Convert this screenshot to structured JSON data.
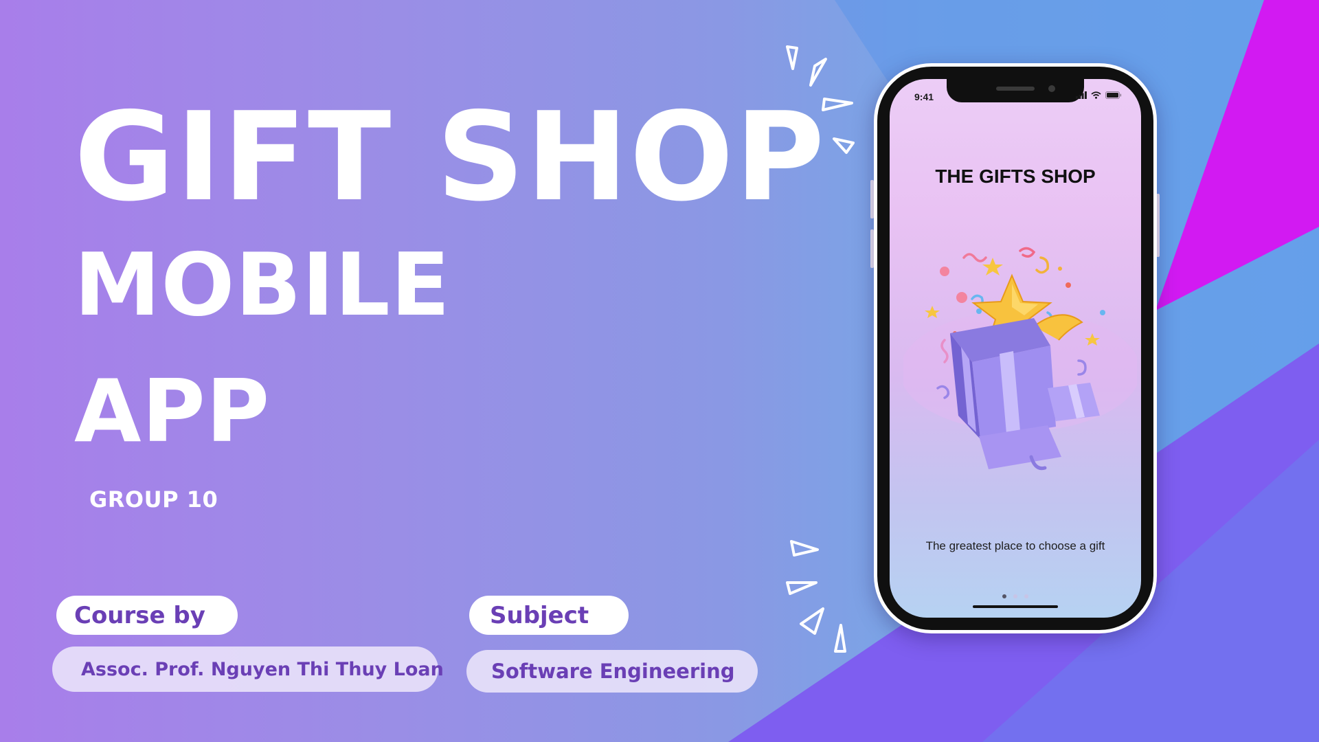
{
  "slide": {
    "title_line1": "GIFT SHOP",
    "title_line2": "MOBILE",
    "title_line3": "APP",
    "group": "GROUP 10"
  },
  "info": {
    "course_label": "Course by",
    "course_value": "Assoc. Prof. Nguyen Thi Thuy Loan",
    "subject_label": "Subject",
    "subject_value": "Software Engineering"
  },
  "phone": {
    "status_time": "9:41",
    "status_icons": [
      "signal-icon",
      "wifi-icon",
      "battery-icon"
    ],
    "app_title": "THE GIFTS SHOP",
    "tagline": "The greatest place to choose a gift",
    "carousel": {
      "pages": 3,
      "active": 1
    },
    "hero_icon": "gift-box-star-illustration"
  },
  "colors": {
    "bg_left": "#a87eea",
    "bg_right": "#70acea",
    "accent_magenta": "#d21af2",
    "accent_violet": "#7e5ef0",
    "pill_text": "#6a3fb5"
  }
}
